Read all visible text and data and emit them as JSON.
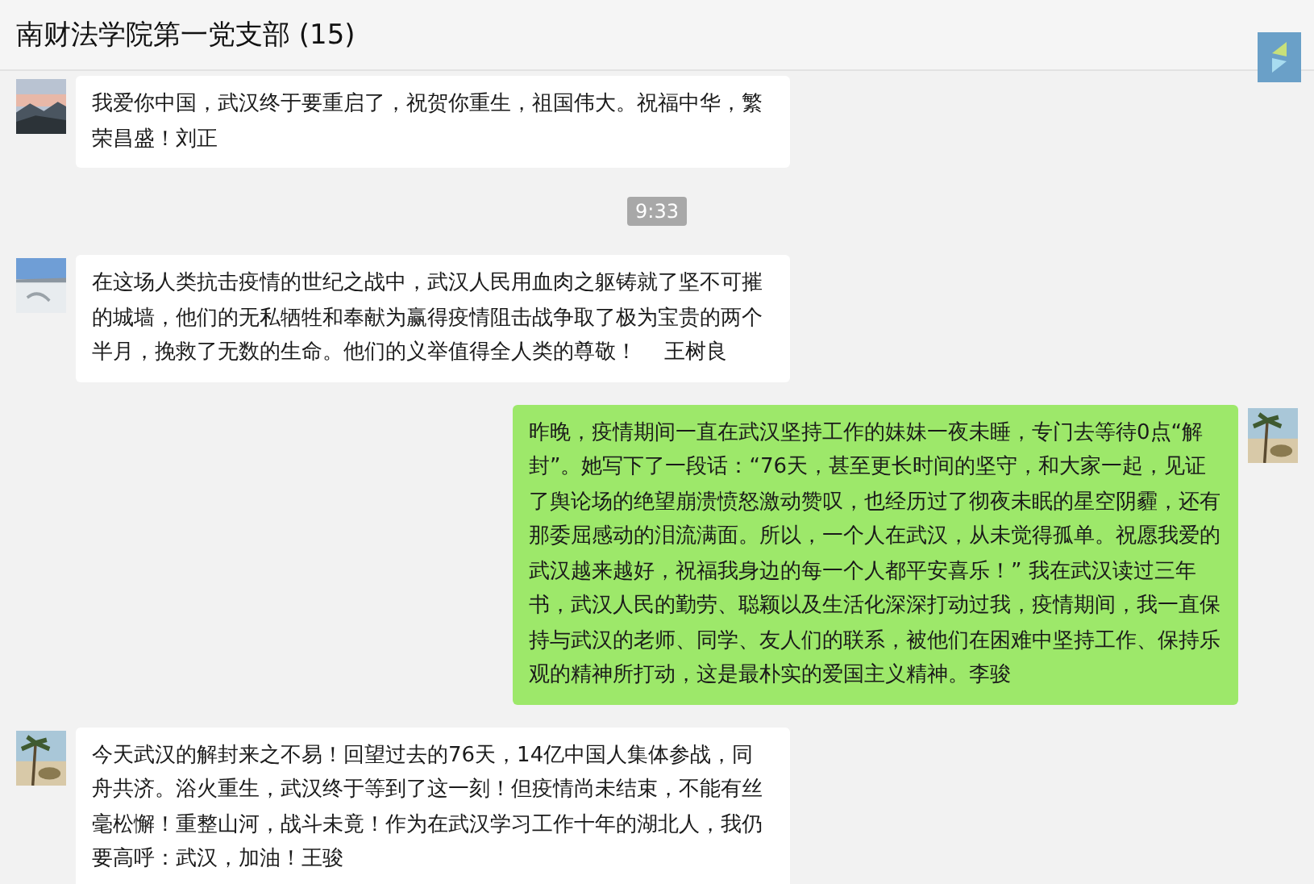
{
  "window": {
    "title": "南财法学院第一党支部 (15)"
  },
  "messages": [
    {
      "kind": "message",
      "outgoing": false,
      "text": "我爱你中国，武汉终于要重启了，祝贺你重生，祖国伟大。祝福中华，繁荣昌盛！刘正"
    },
    {
      "kind": "time",
      "text": "9:33"
    },
    {
      "kind": "message",
      "outgoing": false,
      "text": "在这场人类抗击疫情的世纪之战中，武汉人民用血肉之躯铸就了坚不可摧的城墙，他们的无私牺牲和奉献为赢得疫情阻击战争取了极为宝贵的两个半月，挽救了无数的生命。他们的义举值得全人类的尊敬！　 王树良"
    },
    {
      "kind": "message",
      "outgoing": true,
      "text": "昨晚，疫情期间一直在武汉坚持工作的妹妹一夜未睡，专门去等待0点“解封”。她写下了一段话：“76天，甚至更长时间的坚守，和大家一起，见证了舆论场的绝望崩溃愤怒激动赞叹，也经历过了彻夜未眠的星空阴霾，还有那委屈感动的泪流满面。所以，一个人在武汉，从未觉得孤单。祝愿我爱的武汉越来越好，祝福我身边的每一个人都平安喜乐！” 我在武汉读过三年书，武汉人民的勤劳、聪颖以及生活化深深打动过我，疫情期间，我一直保持与武汉的老师、同学、友人们的联系，被他们在困难中坚持工作、保持乐观的精神所打动，这是最朴实的爱国主义精神。李骏"
    },
    {
      "kind": "message",
      "outgoing": false,
      "text": "今天武汉的解封来之不易！回望过去的76天，14亿中国人集体参战，同舟共济。浴火重生，武汉终于等到了这一刻！但疫情尚未结束，不能有丝毫松懈！重整山河，战斗未竟！作为在武汉学习工作十年的湖北人，我仍要高呼：武汉，加油！王骏"
    }
  ]
}
